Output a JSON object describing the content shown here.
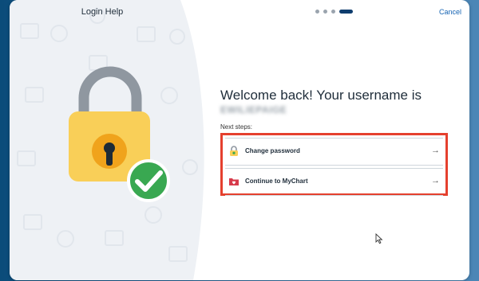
{
  "dialog": {
    "title": "Login Help",
    "cancel_label": "Cancel",
    "step_count": 4,
    "active_step": 4
  },
  "main": {
    "welcome_text": "Welcome back! Your username is",
    "username": "EWILIEPAIGE",
    "next_steps_label": "Next steps:",
    "options": [
      {
        "label": "Change password",
        "icon": "lock-icon",
        "arrow": "→"
      },
      {
        "label": "Continue to MyChart",
        "icon": "mychart-icon",
        "arrow": "→"
      }
    ]
  },
  "colors": {
    "accent": "#1463b3",
    "highlight": "#e5402e",
    "lock_body": "#f9cf58",
    "lock_shackle": "#8f97a0",
    "check_green": "#39a851"
  }
}
